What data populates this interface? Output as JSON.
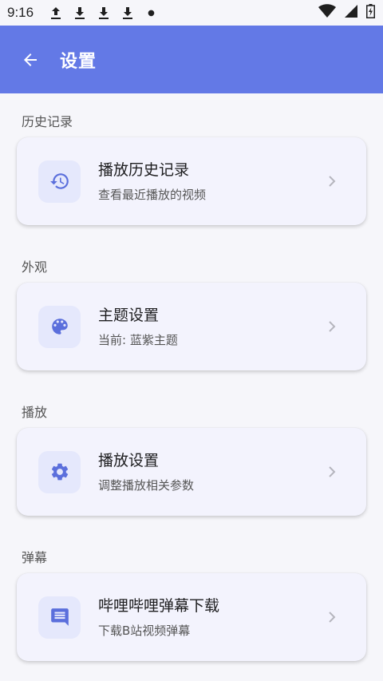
{
  "status_bar": {
    "time": "9:16",
    "icons": [
      "upload-icon",
      "download-icon",
      "download-icon",
      "download-icon",
      "dot-icon",
      "wifi-icon",
      "signal-icon",
      "battery-icon"
    ]
  },
  "app_bar": {
    "title": "设置",
    "back_icon": "arrow-back-icon"
  },
  "sections": [
    {
      "header": "历史记录",
      "card": {
        "title": "播放历史记录",
        "subtitle": "查看最近播放的视频",
        "icon": "history-icon"
      }
    },
    {
      "header": "外观",
      "card": {
        "title": "主题设置",
        "subtitle": "当前: 蓝紫主题",
        "icon": "palette-icon"
      }
    },
    {
      "header": "播放",
      "card": {
        "title": "播放设置",
        "subtitle": "调整播放相关参数",
        "icon": "gear-icon"
      }
    },
    {
      "header": "弹幕",
      "card": {
        "title": "哔哩哔哩弹幕下载",
        "subtitle": "下载B站视频弹幕",
        "icon": "comment-icon"
      }
    }
  ],
  "colors": {
    "app_bar": "#6379e6",
    "icon": "#5b6fdc",
    "icon_bg": "#e5e8fc",
    "card_bg": "#f3f3fd",
    "page_bg": "#f6f6fa"
  }
}
